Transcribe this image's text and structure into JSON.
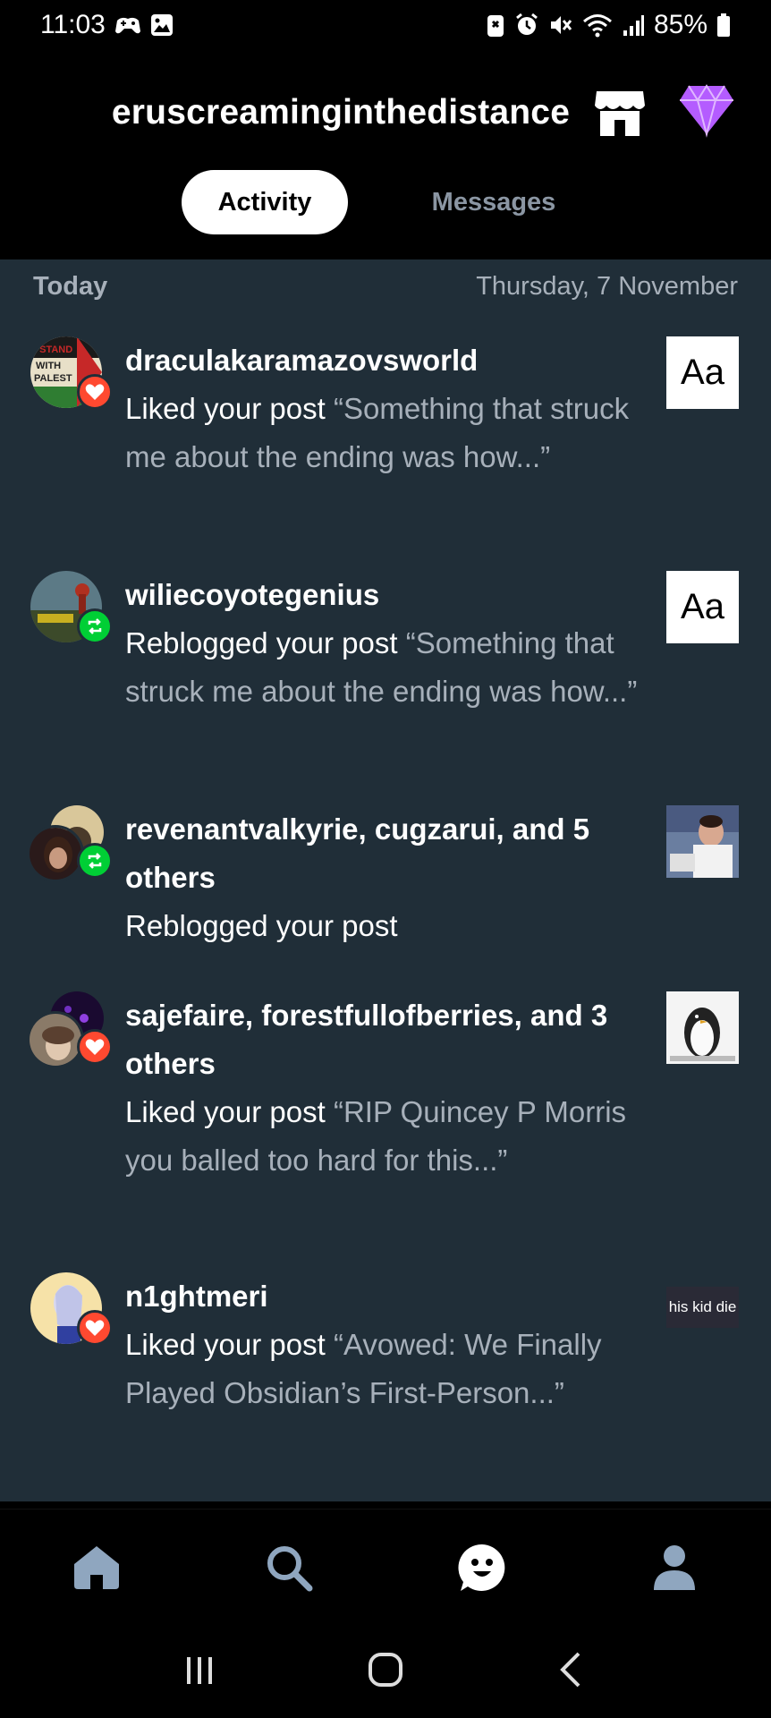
{
  "status_bar": {
    "time": "11:03",
    "battery": "85%"
  },
  "header": {
    "blog_name": "eruscreaminginthedistance"
  },
  "tabs": {
    "activity": "Activity",
    "messages": "Messages"
  },
  "feed": {
    "section_label": "Today",
    "date": "Thursday, 7 November",
    "items": [
      {
        "user": "draculakaramazovsworld",
        "action": "Liked your post",
        "quote": "“Something that struck me about the ending was how...”",
        "badge": "like",
        "avatar_text": [
          "I STAND",
          "WITH",
          "PALEST"
        ],
        "thumb_text": "Aa"
      },
      {
        "user": "wiliecoyotegenius",
        "action": "Reblogged your post",
        "quote": "“Something that struck me about the ending was how...”",
        "badge": "reblog",
        "thumb_text": "Aa"
      },
      {
        "user": "revenantvalkyrie, cugzarui, and 5 others",
        "action": "Reblogged your post",
        "quote": "",
        "badge": "reblog"
      },
      {
        "user": "sajefaire, forestfullofberries, and 3 others",
        "action": "Liked your post",
        "quote": "“RIP Quincey P Morris you balled too hard for this...”",
        "badge": "like"
      },
      {
        "user": "n1ghtmeri",
        "action": "Liked your post",
        "quote": "“Avowed: We Finally Played Obsidian’s First-Person...”",
        "badge": "like",
        "thumb_text": "his kid die"
      }
    ]
  },
  "icons": {
    "status_left": [
      "game-controller-icon",
      "image-icon"
    ],
    "status_right": [
      "battery-saver-icon",
      "alarm-icon",
      "mute-icon",
      "wifi-icon",
      "signal-icon",
      "battery-icon"
    ],
    "header": [
      "shop-icon",
      "gem-icon"
    ],
    "bottom_nav": [
      "home-icon",
      "search-icon",
      "activity-face-icon",
      "account-icon"
    ],
    "system_nav": [
      "recents-icon",
      "home-circle-icon",
      "back-icon"
    ]
  },
  "colors": {
    "feed_bg": "#202e38",
    "like_badge": "#ff4930",
    "reblog_badge": "#00cf35",
    "muted_text": "#a7b0ba",
    "gem": "#b45cff"
  }
}
